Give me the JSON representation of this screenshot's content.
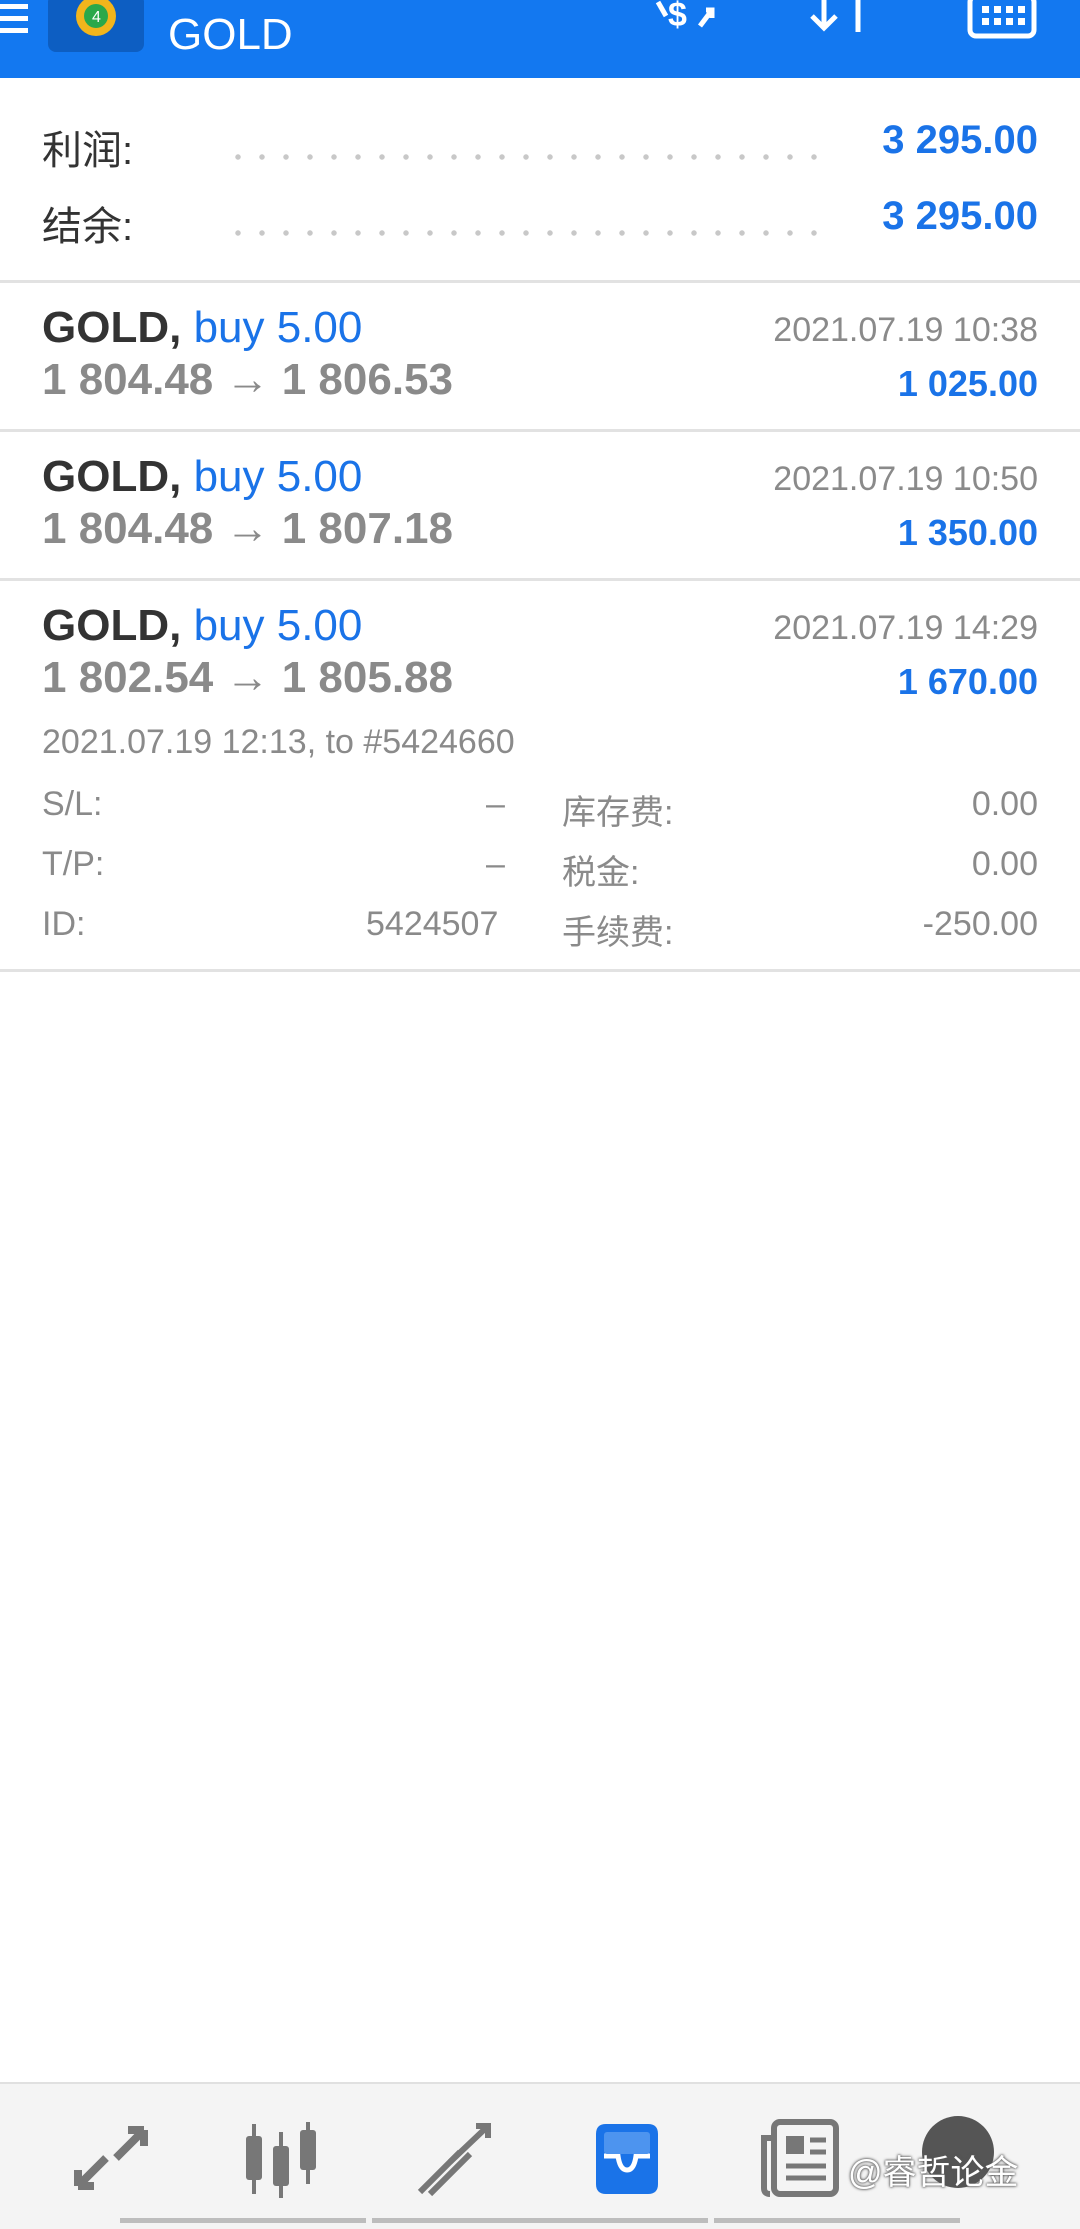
{
  "header": {
    "title": "GOLD"
  },
  "summary": {
    "profit_label": "利润:",
    "profit_value": "3 295.00",
    "balance_label": "结余:",
    "balance_value": "3 295.00"
  },
  "trades": [
    {
      "symbol": "GOLD,",
      "side": "buy 5.00",
      "prices": "1 804.48 → 1 806.53",
      "time": "2021.07.19 10:38",
      "profit": "1 025.00"
    },
    {
      "symbol": "GOLD,",
      "side": "buy 5.00",
      "prices": "1 804.48 → 1 807.18",
      "time": "2021.07.19 10:50",
      "profit": "1 350.00"
    },
    {
      "symbol": "GOLD,",
      "side": "buy 5.00",
      "prices": "1 802.54 → 1 805.88",
      "time": "2021.07.19 14:29",
      "profit": "1 670.00"
    }
  ],
  "detail": {
    "open_info": "2021.07.19 12:13, to #5424660",
    "sl_label": "S/L:",
    "sl_value": "–",
    "tp_label": "T/P:",
    "tp_value": "–",
    "id_label": "ID:",
    "id_value": "5424507",
    "swap_label": "库存费:",
    "swap_value": "0.00",
    "tax_label": "税金:",
    "tax_value": "0.00",
    "commission_label": "手续费:",
    "commission_value": "-250.00"
  },
  "nav": {
    "items": [
      "quotes-icon",
      "chart-icon",
      "trade-icon",
      "history-icon",
      "news-icon",
      "chat-icon"
    ],
    "active": "history-icon"
  },
  "watermark": "@睿哲论金",
  "colors": {
    "topbar": "#1378f0",
    "accent": "#1a73e8",
    "muted": "#8a8a8a"
  }
}
